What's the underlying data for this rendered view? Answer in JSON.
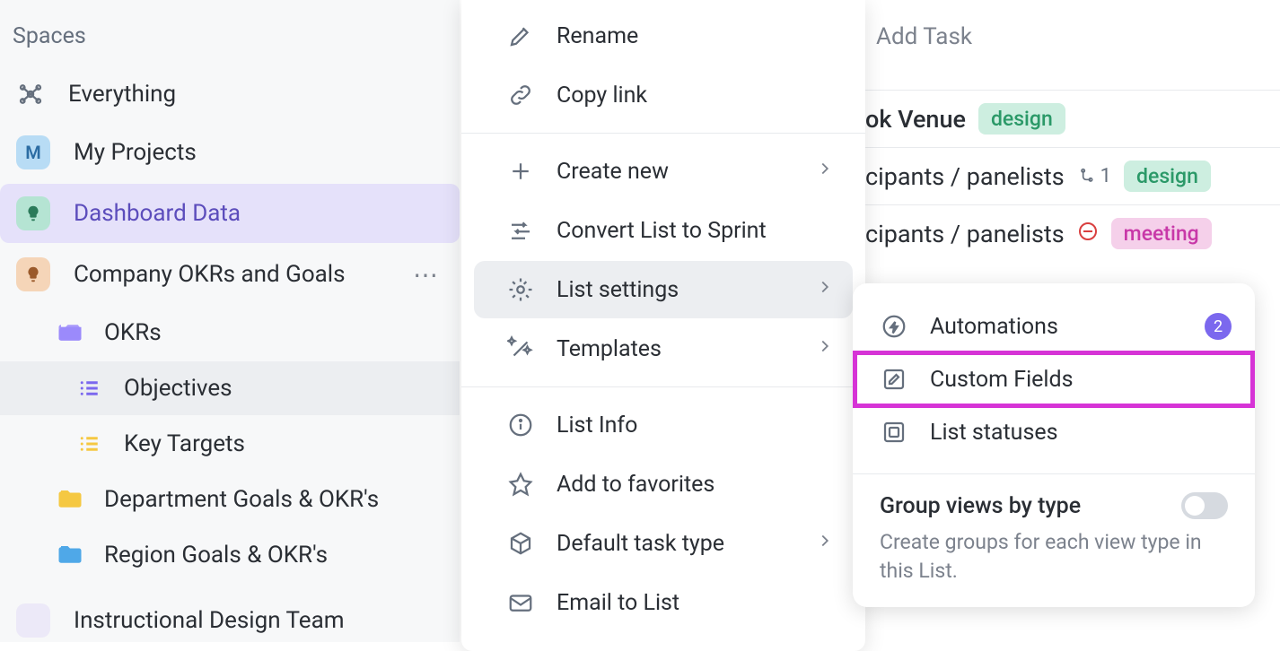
{
  "sidebar": {
    "header": "Spaces",
    "items": [
      {
        "label": "Everything"
      },
      {
        "label": "My Projects",
        "avatar": "M"
      },
      {
        "label": "Dashboard Data"
      },
      {
        "label": "Company OKRs and Goals"
      }
    ],
    "okrs_folder": "OKRs",
    "objectives": "Objectives",
    "key_targets": "Key Targets",
    "dept": "Department Goals & OKR's",
    "region": "Region Goals & OKR's",
    "instructional": "Instructional Design Team"
  },
  "menu": {
    "rename": "Rename",
    "copy_link": "Copy link",
    "create_new": "Create new",
    "convert": "Convert List to Sprint",
    "list_settings": "List settings",
    "templates": "Templates",
    "list_info": "List Info",
    "favorites": "Add to favorites",
    "default_task": "Default task type",
    "email": "Email to List"
  },
  "submenu": {
    "automations": "Automations",
    "automations_count": "2",
    "custom_fields": "Custom Fields",
    "list_statuses": "List statuses",
    "group_title": "Group views by type",
    "group_desc": "Create groups for each view type in this List."
  },
  "content": {
    "add_task": "Add Task",
    "task1": "ok Venue",
    "tag_design": "design",
    "task2": "cipants / panelists",
    "subtask_count": "1",
    "task3": "cipants / panelists",
    "tag_meeting": "meeting"
  }
}
